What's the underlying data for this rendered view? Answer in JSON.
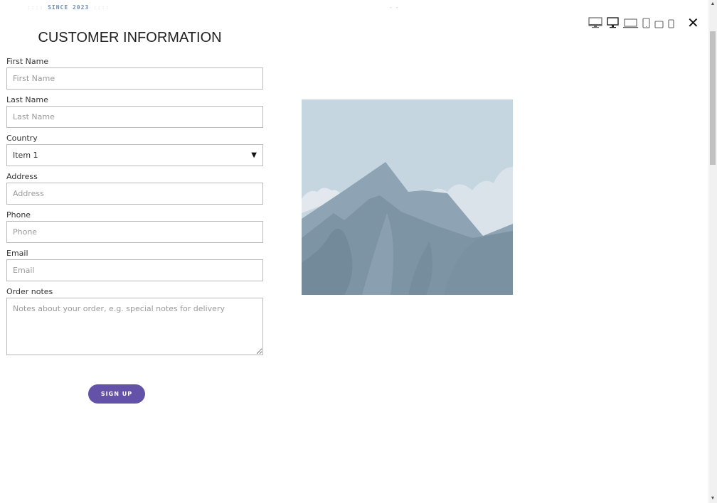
{
  "branding": {
    "since": "SINCE 2023"
  },
  "header": {
    "title": "CUSTOMER INFORMATION"
  },
  "form": {
    "first_name": {
      "label": "First Name",
      "placeholder": "First Name"
    },
    "last_name": {
      "label": "Last Name",
      "placeholder": "Last Name"
    },
    "country": {
      "label": "Country",
      "value": "Item 1"
    },
    "address": {
      "label": "Address",
      "placeholder": "Address"
    },
    "phone": {
      "label": "Phone",
      "placeholder": "Phone"
    },
    "email": {
      "label": "Email",
      "placeholder": "Email"
    },
    "order_notes": {
      "label": "Order notes",
      "placeholder": "Notes about your order, e.g. special notes for delivery"
    },
    "submit_label": "SIGN UP"
  },
  "toolbar": {
    "devices": [
      "desktop-wide-icon",
      "desktop-icon",
      "laptop-icon",
      "tablet-portrait-icon",
      "tablet-landscape-icon",
      "mobile-icon"
    ],
    "close_icon": "close-icon"
  },
  "colors": {
    "accent": "#6452a8",
    "sky": "#c5d6e0",
    "mountain": "#8ea3b3"
  }
}
